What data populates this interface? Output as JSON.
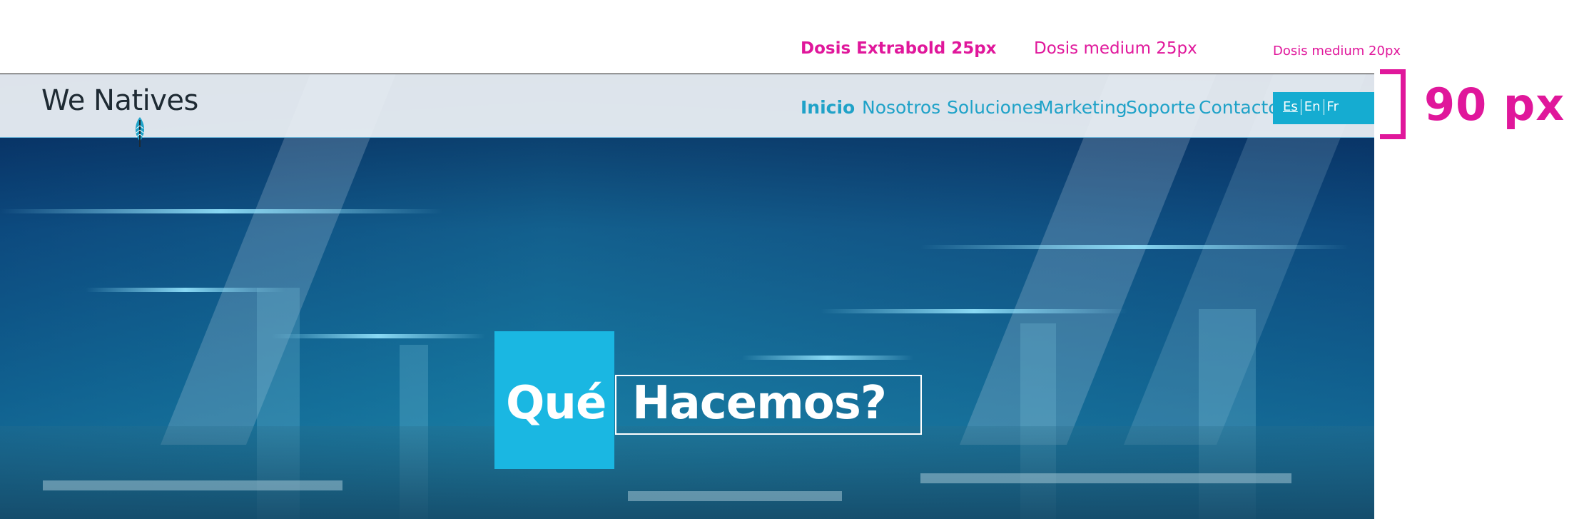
{
  "annotations": {
    "nav_active_font": "Dosis Extrabold 25px",
    "nav_font": "Dosis medium 25px",
    "lang_font": "Dosis medium 20px",
    "header_height": "90 px"
  },
  "brand": {
    "logo_text": "We Natives",
    "logo_icon": "feather-icon"
  },
  "nav": {
    "items": [
      {
        "label": "Inicio",
        "active": true
      },
      {
        "label": "Nosotros",
        "active": false
      },
      {
        "label": "Soluciones",
        "active": false
      },
      {
        "label": "Marketing",
        "active": false
      },
      {
        "label": "Soporte",
        "active": false
      },
      {
        "label": "Contacto",
        "active": false
      }
    ]
  },
  "language": {
    "options": [
      "Es",
      "En",
      "Fr"
    ],
    "selected": "Es"
  },
  "hero": {
    "title_part1": "Qué",
    "title_part2": "Hacemos?",
    "background": "office-photo"
  },
  "colors": {
    "annotation": "#e0179b",
    "accent": "#15acd1",
    "nav_text": "#1fa2c8",
    "header_bg": "#eef2f6"
  }
}
